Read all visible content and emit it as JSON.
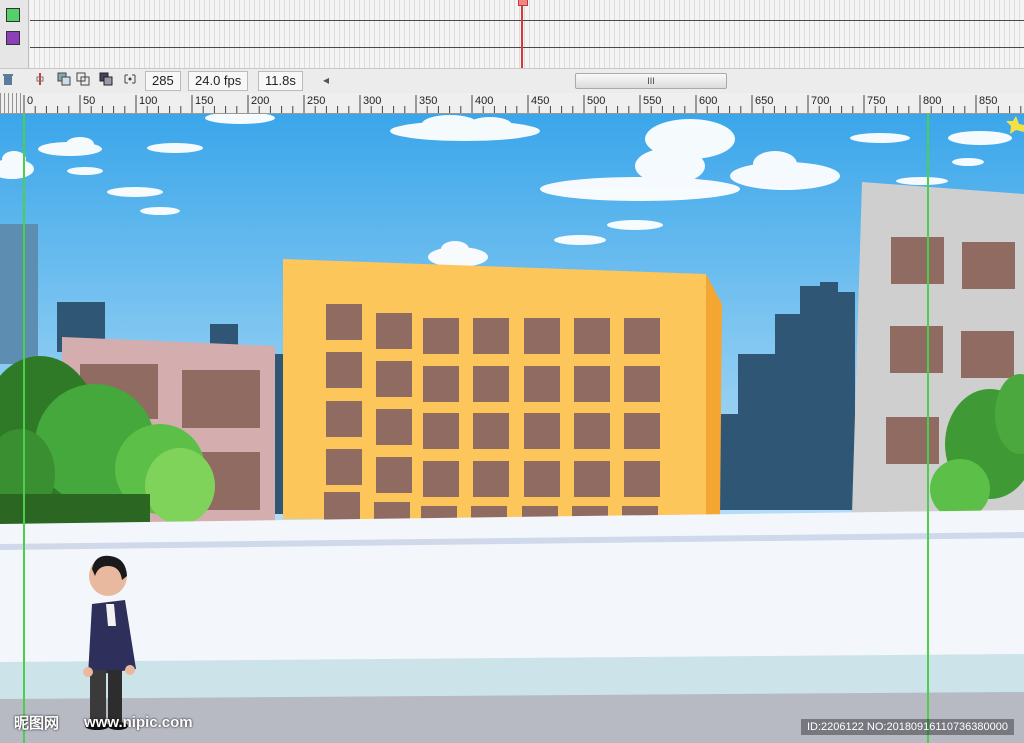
{
  "timeline": {
    "layers": [
      {
        "color": "#54d06a"
      },
      {
        "color": "#8c3fb6"
      }
    ]
  },
  "controls": {
    "current_frame": "285",
    "fps": "24.0 fps",
    "elapsed": "11.8s",
    "scroll_left_glyph": "◂",
    "scroll_thumb_glyph": "III"
  },
  "ruler": {
    "labels": [
      "0",
      "50",
      "100",
      "150",
      "200",
      "250",
      "300",
      "350",
      "400",
      "450",
      "500",
      "550",
      "600",
      "650",
      "700",
      "750",
      "800",
      "850"
    ]
  },
  "watermark": {
    "logo_text": "昵图网",
    "site": "www.nipic.com",
    "id_text": "ID:2206122 NO:20180916110736380000"
  },
  "colors": {
    "playhead": "#d23a3a",
    "guide": "#4cd04c",
    "sky": "#3aa6ea",
    "yellow_building": "#fcc65a",
    "pink_building": "#d4aeae",
    "gray_building": "#cfcfcf",
    "window": "#8f6b62",
    "tree": "#44a83c"
  }
}
